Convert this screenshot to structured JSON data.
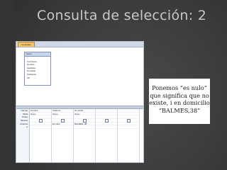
{
  "slide": {
    "title": "Consulta de selección: 2"
  },
  "window": {
    "tab_label": "Consulta1",
    "table_box": {
      "title": "Socio",
      "fields": [
        "*",
        "Cód Socio",
        "Nombre",
        "Apellidos",
        "Domicilio",
        "Población",
        "CP"
      ]
    },
    "grid": {
      "row_labels": [
        "Campo:",
        "Tabla:",
        "Orden:",
        "Mostrar:",
        "Criterios:",
        "o:"
      ],
      "columns": [
        {
          "campo": "Nombre",
          "tabla": "Socio",
          "criterio": ""
        },
        {
          "campo": "Teléfono",
          "tabla": "Socio",
          "criterio": "Es Nulo"
        },
        {
          "campo": "Domicilio",
          "tabla": "Socio",
          "criterio": "BALMES, 38"
        },
        {
          "campo": "",
          "tabla": "",
          "criterio": ""
        },
        {
          "campo": "",
          "tabla": "",
          "criterio": ""
        }
      ]
    }
  },
  "note": {
    "text": "Ponemos “es nulo” que significa que no existe, i en domicilio “BALMES,38”"
  }
}
